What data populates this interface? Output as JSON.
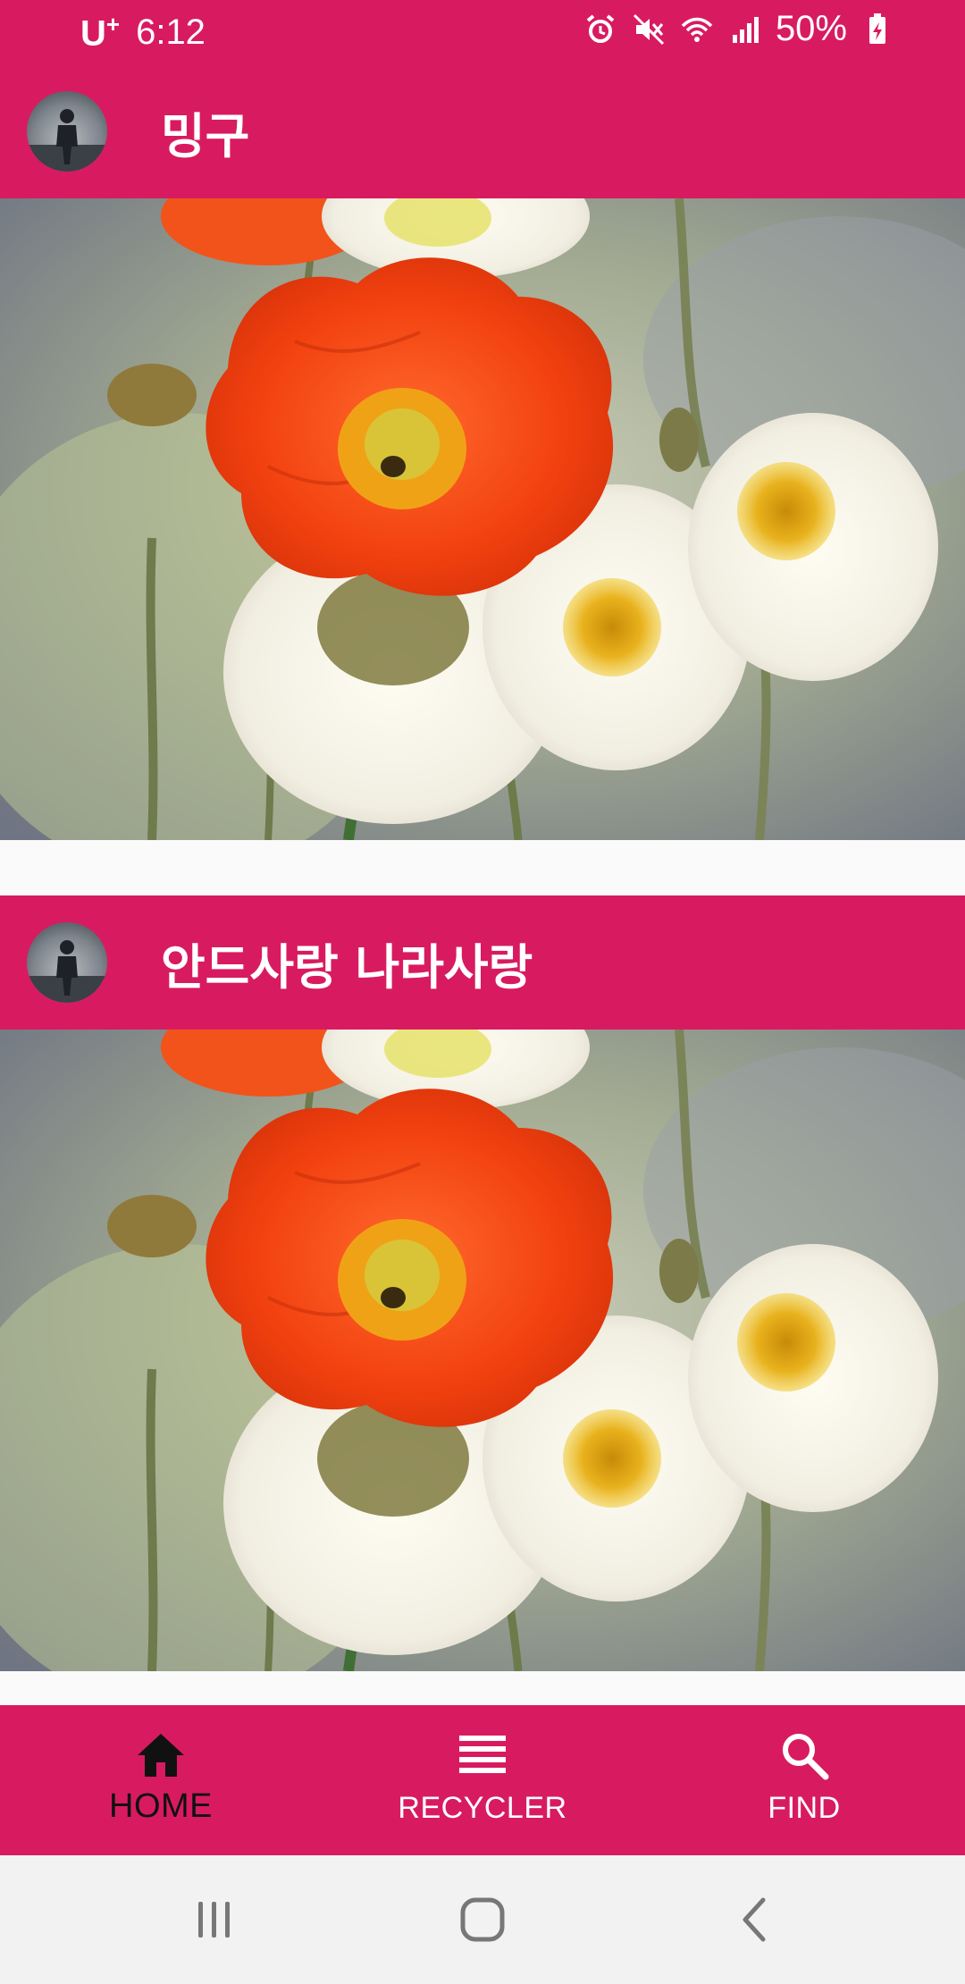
{
  "status_bar": {
    "carrier": "U",
    "carrier_sup": "+",
    "time": "6:12",
    "battery": "50%",
    "icons": [
      "alarm-icon",
      "mute-icon",
      "wifi-icon",
      "signal-icon",
      "battery-charging-icon"
    ]
  },
  "feed": {
    "items": [
      {
        "title": "밍구",
        "image": "poppy-flowers"
      },
      {
        "title": "안드사랑 나라사랑",
        "image": "poppy-flowers"
      }
    ]
  },
  "bottom_nav": {
    "items": [
      {
        "label": "HOME",
        "icon": "home-icon",
        "active": true
      },
      {
        "label": "RECYCLER",
        "icon": "list-icon",
        "active": false
      },
      {
        "label": "FIND",
        "icon": "search-icon",
        "active": false
      }
    ]
  },
  "system_nav": {
    "buttons": [
      "recents-icon",
      "home-circle-icon",
      "back-icon"
    ]
  },
  "colors": {
    "primary": "#d81b60",
    "system_nav": "#f2f2f2",
    "background": "#fafafa"
  }
}
